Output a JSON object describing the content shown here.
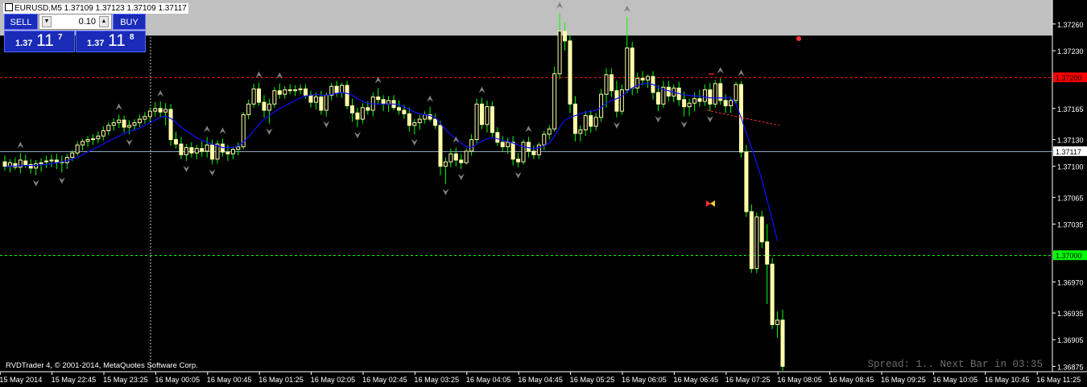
{
  "header": {
    "symbol_line": "EURUSD,M5  1.37109 1.37123 1.37109 1.37117"
  },
  "trade_panel": {
    "sell_label": "SELL",
    "buy_label": "BUY",
    "lot": "0.10",
    "bid_prefix": "1.37",
    "bid_big": "11",
    "bid_sup": "7",
    "ask_prefix": "1.37",
    "ask_big": "11",
    "ask_sup": "8"
  },
  "footer": {
    "copyright": "RVDTrader 4, © 2001-2014, MetaQuotes Software Corp.",
    "status": "Spread: 1.. Next Bar in 03:35"
  },
  "colors": {
    "background": "#000000",
    "candle": "#ffffaa",
    "wick": "#00ff00",
    "ma": "#0000ff",
    "red_level": "#ff0000",
    "green_level": "#00ff00",
    "fractal": "#808080",
    "grid_line": "#8aa6bf"
  },
  "chart_data": {
    "type": "candlestick",
    "symbol": "EURUSD",
    "timeframe": "M5",
    "y_axis_labels": [
      "1.37260",
      "1.37230",
      "1.37200",
      "1.37165",
      "1.37130",
      "1.37117",
      "1.37100",
      "1.37065",
      "1.37035",
      "1.37000",
      "1.36970",
      "1.36935",
      "1.36905",
      "1.36875"
    ],
    "ylim": [
      1.36869,
      1.37287
    ],
    "x_labels": [
      "15 May 2014",
      "15 May 22:45",
      "15 May 23:25",
      "16 May 00:05",
      "16 May 00:45",
      "16 May 01:25",
      "16 May 02:05",
      "16 May 02:45",
      "16 May 03:25",
      "16 May 04:05",
      "16 May 04:45",
      "16 May 05:25",
      "16 May 06:05",
      "16 May 06:45",
      "16 May 07:25",
      "16 May 08:05",
      "16 May 08:45",
      "16 May 09:25",
      "16 May 10:05",
      "16 May 10:45",
      "16 May 11:25"
    ],
    "horizontal_levels": [
      {
        "value": 1.372,
        "label": "1.37200",
        "color": "#ff0000",
        "style": "dashed"
      },
      {
        "value": 1.37,
        "label": "1.37000",
        "color": "#00ff00",
        "style": "dashed"
      },
      {
        "value": 1.37117,
        "label": "1.37117",
        "color": "#8aa6bf",
        "style": "solid"
      }
    ],
    "shaded_zone": [
      1.37247,
      1.37287
    ],
    "candles": [
      [
        1.37105,
        1.37112,
        1.37095,
        1.371
      ],
      [
        1.371,
        1.37108,
        1.37093,
        1.37104
      ],
      [
        1.37103,
        1.3711,
        1.37096,
        1.37099
      ],
      [
        1.37099,
        1.37115,
        1.37092,
        1.37107
      ],
      [
        1.37106,
        1.37113,
        1.37098,
        1.37102
      ],
      [
        1.37102,
        1.37108,
        1.37092,
        1.37098
      ],
      [
        1.37098,
        1.37107,
        1.3709,
        1.37103
      ],
      [
        1.37103,
        1.37109,
        1.37094,
        1.37104
      ],
      [
        1.37105,
        1.37112,
        1.37098,
        1.37106
      ],
      [
        1.37106,
        1.37113,
        1.37099,
        1.37107
      ],
      [
        1.37107,
        1.37114,
        1.37097,
        1.37105
      ],
      [
        1.37105,
        1.37112,
        1.37093,
        1.37104
      ],
      [
        1.37104,
        1.37114,
        1.37097,
        1.3711
      ],
      [
        1.3711,
        1.37118,
        1.37106,
        1.37115
      ],
      [
        1.37115,
        1.37128,
        1.37112,
        1.37124
      ],
      [
        1.37124,
        1.37131,
        1.37118,
        1.37128
      ],
      [
        1.37128,
        1.37134,
        1.37122,
        1.3713
      ],
      [
        1.3713,
        1.37136,
        1.37124,
        1.37131
      ],
      [
        1.37131,
        1.37139,
        1.37126,
        1.37134
      ],
      [
        1.37134,
        1.37145,
        1.37129,
        1.3714
      ],
      [
        1.3714,
        1.3715,
        1.37135,
        1.37146
      ],
      [
        1.37146,
        1.37154,
        1.3714,
        1.37149
      ],
      [
        1.37149,
        1.37158,
        1.37143,
        1.37152
      ],
      [
        1.37152,
        1.37157,
        1.37138,
        1.37144
      ],
      [
        1.37144,
        1.37152,
        1.37136,
        1.37146
      ],
      [
        1.37146,
        1.37153,
        1.3714,
        1.37149
      ],
      [
        1.37149,
        1.37158,
        1.37144,
        1.37153
      ],
      [
        1.37153,
        1.37161,
        1.37148,
        1.37156
      ],
      [
        1.37156,
        1.37166,
        1.3715,
        1.37162
      ],
      [
        1.37162,
        1.37172,
        1.37156,
        1.37165
      ],
      [
        1.37165,
        1.37173,
        1.37155,
        1.37161
      ],
      [
        1.37161,
        1.37171,
        1.37146,
        1.37164
      ],
      [
        1.37164,
        1.3717,
        1.37123,
        1.3713
      ],
      [
        1.3713,
        1.37139,
        1.3712,
        1.37125
      ],
      [
        1.37125,
        1.37133,
        1.37108,
        1.37113
      ],
      [
        1.37113,
        1.37125,
        1.37106,
        1.37121
      ],
      [
        1.37121,
        1.37127,
        1.3711,
        1.37115
      ],
      [
        1.37115,
        1.37124,
        1.37108,
        1.3712
      ],
      [
        1.3712,
        1.37128,
        1.37111,
        1.37117
      ],
      [
        1.37117,
        1.37133,
        1.3711,
        1.37124
      ],
      [
        1.37124,
        1.3713,
        1.37102,
        1.37108
      ],
      [
        1.37108,
        1.37129,
        1.37103,
        1.37125
      ],
      [
        1.37125,
        1.37131,
        1.37111,
        1.37116
      ],
      [
        1.37116,
        1.37124,
        1.37106,
        1.37114
      ],
      [
        1.37114,
        1.37122,
        1.37108,
        1.37119
      ],
      [
        1.37119,
        1.37127,
        1.37112,
        1.37122
      ],
      [
        1.37122,
        1.37161,
        1.37119,
        1.37158
      ],
      [
        1.37158,
        1.37175,
        1.37153,
        1.3717
      ],
      [
        1.3717,
        1.37193,
        1.37166,
        1.37187
      ],
      [
        1.37187,
        1.37194,
        1.37168,
        1.37172
      ],
      [
        1.37172,
        1.3718,
        1.37155,
        1.37163
      ],
      [
        1.37163,
        1.37176,
        1.37148,
        1.3717
      ],
      [
        1.3717,
        1.37189,
        1.37166,
        1.37185
      ],
      [
        1.37185,
        1.37193,
        1.37176,
        1.37181
      ],
      [
        1.37181,
        1.3719,
        1.37176,
        1.37186
      ],
      [
        1.37186,
        1.37192,
        1.37181,
        1.37185
      ],
      [
        1.37185,
        1.37191,
        1.37179,
        1.37186
      ],
      [
        1.37186,
        1.37192,
        1.37181,
        1.37187
      ],
      [
        1.37187,
        1.37192,
        1.37176,
        1.3718
      ],
      [
        1.3718,
        1.37185,
        1.37166,
        1.37172
      ],
      [
        1.37172,
        1.37183,
        1.37164,
        1.37178
      ],
      [
        1.37178,
        1.37185,
        1.37158,
        1.37163
      ],
      [
        1.37163,
        1.37183,
        1.37156,
        1.3718
      ],
      [
        1.3718,
        1.37194,
        1.37174,
        1.3719
      ],
      [
        1.3719,
        1.37196,
        1.37178,
        1.37183
      ],
      [
        1.37183,
        1.37194,
        1.37177,
        1.37191
      ],
      [
        1.37191,
        1.37196,
        1.37164,
        1.37168
      ],
      [
        1.37168,
        1.37176,
        1.3715,
        1.3716
      ],
      [
        1.3716,
        1.37166,
        1.37144,
        1.37153
      ],
      [
        1.37153,
        1.37171,
        1.37148,
        1.37166
      ],
      [
        1.37166,
        1.37173,
        1.37158,
        1.37163
      ],
      [
        1.37163,
        1.37183,
        1.37156,
        1.37178
      ],
      [
        1.37178,
        1.37188,
        1.3717,
        1.37175
      ],
      [
        1.37175,
        1.3718,
        1.37162,
        1.3717
      ],
      [
        1.3717,
        1.37179,
        1.37161,
        1.37174
      ],
      [
        1.37174,
        1.3718,
        1.37163,
        1.37166
      ],
      [
        1.37166,
        1.37174,
        1.37158,
        1.37163
      ],
      [
        1.37163,
        1.37169,
        1.37153,
        1.37159
      ],
      [
        1.37159,
        1.37166,
        1.37139,
        1.37146
      ],
      [
        1.37146,
        1.37153,
        1.37136,
        1.37149
      ],
      [
        1.37149,
        1.37158,
        1.37141,
        1.37153
      ],
      [
        1.37153,
        1.37162,
        1.37148,
        1.37158
      ],
      [
        1.37158,
        1.37167,
        1.3715,
        1.37153
      ],
      [
        1.37153,
        1.37159,
        1.37142,
        1.37146
      ],
      [
        1.37146,
        1.37151,
        1.3709,
        1.371
      ],
      [
        1.371,
        1.3711,
        1.3708,
        1.37105
      ],
      [
        1.37105,
        1.3712,
        1.37099,
        1.37114
      ],
      [
        1.37114,
        1.37121,
        1.371,
        1.37107
      ],
      [
        1.37107,
        1.37114,
        1.37097,
        1.37104
      ],
      [
        1.37104,
        1.3712,
        1.37102,
        1.37117
      ],
      [
        1.37117,
        1.37136,
        1.37112,
        1.3713
      ],
      [
        1.3713,
        1.37176,
        1.37126,
        1.3717
      ],
      [
        1.3717,
        1.37177,
        1.37142,
        1.37147
      ],
      [
        1.37147,
        1.37174,
        1.37138,
        1.37167
      ],
      [
        1.37167,
        1.37173,
        1.37133,
        1.37138
      ],
      [
        1.37138,
        1.37144,
        1.37123,
        1.37127
      ],
      [
        1.37127,
        1.37134,
        1.37117,
        1.37122
      ],
      [
        1.37122,
        1.37132,
        1.37114,
        1.37127
      ],
      [
        1.37127,
        1.37134,
        1.37101,
        1.37108
      ],
      [
        1.37108,
        1.37115,
        1.37099,
        1.37105
      ],
      [
        1.37105,
        1.3713,
        1.37102,
        1.37127
      ],
      [
        1.37127,
        1.37133,
        1.3711,
        1.37117
      ],
      [
        1.37117,
        1.37123,
        1.37108,
        1.37113
      ],
      [
        1.37113,
        1.37127,
        1.37108,
        1.37124
      ],
      [
        1.37124,
        1.3714,
        1.37118,
        1.37136
      ],
      [
        1.37136,
        1.37146,
        1.3713,
        1.37142
      ],
      [
        1.37142,
        1.37212,
        1.37139,
        1.37204
      ],
      [
        1.37204,
        1.37272,
        1.37198,
        1.37252
      ],
      [
        1.37252,
        1.37262,
        1.3723,
        1.37241
      ],
      [
        1.37241,
        1.37248,
        1.3716,
        1.3717
      ],
      [
        1.3717,
        1.37179,
        1.37128,
        1.37137
      ],
      [
        1.37137,
        1.37146,
        1.37128,
        1.37141
      ],
      [
        1.37141,
        1.37162,
        1.37134,
        1.37157
      ],
      [
        1.37157,
        1.37163,
        1.37138,
        1.37145
      ],
      [
        1.37145,
        1.3716,
        1.3714,
        1.37155
      ],
      [
        1.37155,
        1.37187,
        1.3715,
        1.37181
      ],
      [
        1.37181,
        1.3721,
        1.37166,
        1.37203
      ],
      [
        1.37203,
        1.3721,
        1.37178,
        1.37185
      ],
      [
        1.37185,
        1.37196,
        1.37155,
        1.37162
      ],
      [
        1.37162,
        1.37192,
        1.37158,
        1.37186
      ],
      [
        1.37186,
        1.37268,
        1.37182,
        1.37233
      ],
      [
        1.37233,
        1.3724,
        1.3718,
        1.37188
      ],
      [
        1.37188,
        1.37205,
        1.37182,
        1.37199
      ],
      [
        1.37199,
        1.37207,
        1.37191,
        1.37197
      ],
      [
        1.37197,
        1.37203,
        1.37188,
        1.37201
      ],
      [
        1.37201,
        1.37207,
        1.37175,
        1.37183
      ],
      [
        1.37183,
        1.37191,
        1.37162,
        1.3717
      ],
      [
        1.3717,
        1.37196,
        1.37166,
        1.37189
      ],
      [
        1.37189,
        1.37196,
        1.37173,
        1.37179
      ],
      [
        1.37179,
        1.37192,
        1.37172,
        1.37188
      ],
      [
        1.37188,
        1.37195,
        1.37168,
        1.37175
      ],
      [
        1.37175,
        1.37184,
        1.37156,
        1.37167
      ],
      [
        1.37167,
        1.37176,
        1.37157,
        1.37171
      ],
      [
        1.37171,
        1.37183,
        1.37162,
        1.37176
      ],
      [
        1.37176,
        1.37186,
        1.37167,
        1.37173
      ],
      [
        1.37173,
        1.37192,
        1.37168,
        1.37186
      ],
      [
        1.37186,
        1.37194,
        1.37162,
        1.3717
      ],
      [
        1.3717,
        1.37197,
        1.37166,
        1.37193
      ],
      [
        1.37193,
        1.37199,
        1.37169,
        1.37174
      ],
      [
        1.37174,
        1.37181,
        1.3716,
        1.37168
      ],
      [
        1.37168,
        1.37178,
        1.3716,
        1.37174
      ],
      [
        1.37174,
        1.37195,
        1.3717,
        1.37192
      ],
      [
        1.37192,
        1.37196,
        1.3711,
        1.37116
      ],
      [
        1.37116,
        1.37124,
        1.37043,
        1.37049
      ],
      [
        1.37049,
        1.37057,
        1.3698,
        1.36985
      ],
      [
        1.36985,
        1.37048,
        1.3698,
        1.37043
      ],
      [
        1.37043,
        1.3705,
        1.37008,
        1.37015
      ],
      [
        1.37015,
        1.37035,
        1.36945,
        1.3699
      ],
      [
        1.3699,
        1.36997,
        1.36917,
        1.36922
      ],
      [
        1.36922,
        1.36937,
        1.36907,
        1.36927
      ],
      [
        1.36927,
        1.36939,
        1.3687,
        1.36875
      ]
    ],
    "moving_average": [
      1.37099,
      1.371,
      1.371,
      1.37101,
      1.37101,
      1.37101,
      1.37101,
      1.37102,
      1.37102,
      1.37103,
      1.37104,
      1.37105,
      1.37106,
      1.37108,
      1.3711,
      1.37113,
      1.37116,
      1.37119,
      1.37122,
      1.37125,
      1.37128,
      1.37131,
      1.37134,
      1.37137,
      1.37139,
      1.37141,
      1.37143,
      1.37146,
      1.37149,
      1.37152,
      1.37155,
      1.37156,
      1.37154,
      1.37149,
      1.37144,
      1.3714,
      1.37136,
      1.37132,
      1.37129,
      1.37127,
      1.37125,
      1.37123,
      1.37121,
      1.37121,
      1.37121,
      1.37123,
      1.37127,
      1.37133,
      1.3714,
      1.37147,
      1.37153,
      1.37157,
      1.37161,
      1.37165,
      1.37168,
      1.37171,
      1.37174,
      1.37177,
      1.37179,
      1.3718,
      1.37181,
      1.3718,
      1.3718,
      1.37181,
      1.37182,
      1.37183,
      1.37182,
      1.3718,
      1.37176,
      1.37173,
      1.37171,
      1.3717,
      1.3717,
      1.3717,
      1.3717,
      1.3717,
      1.37169,
      1.37167,
      1.37164,
      1.37161,
      1.37159,
      1.37158,
      1.37157,
      1.37155,
      1.37148,
      1.37141,
      1.37136,
      1.37131,
      1.37126,
      1.37122,
      1.37121,
      1.37125,
      1.37128,
      1.37131,
      1.37132,
      1.37131,
      1.37129,
      1.37128,
      1.37126,
      1.37124,
      1.37122,
      1.37121,
      1.3712,
      1.37121,
      1.37123,
      1.37126,
      1.37134,
      1.37144,
      1.37152,
      1.37155,
      1.37157,
      1.37159,
      1.37161,
      1.37162,
      1.37163,
      1.37166,
      1.37171,
      1.37174,
      1.37176,
      1.37179,
      1.37184,
      1.37188,
      1.37191,
      1.37193,
      1.37193,
      1.37192,
      1.37189,
      1.37186,
      1.37185,
      1.37183,
      1.37182,
      1.3718,
      1.3718,
      1.37179,
      1.37179,
      1.37178,
      1.37177,
      1.37177,
      1.37177,
      1.37177,
      1.37177,
      1.3717,
      1.37155,
      1.37137,
      1.37121,
      1.37104,
      1.37085,
      1.37062,
      1.3704,
      1.37016
    ]
  }
}
